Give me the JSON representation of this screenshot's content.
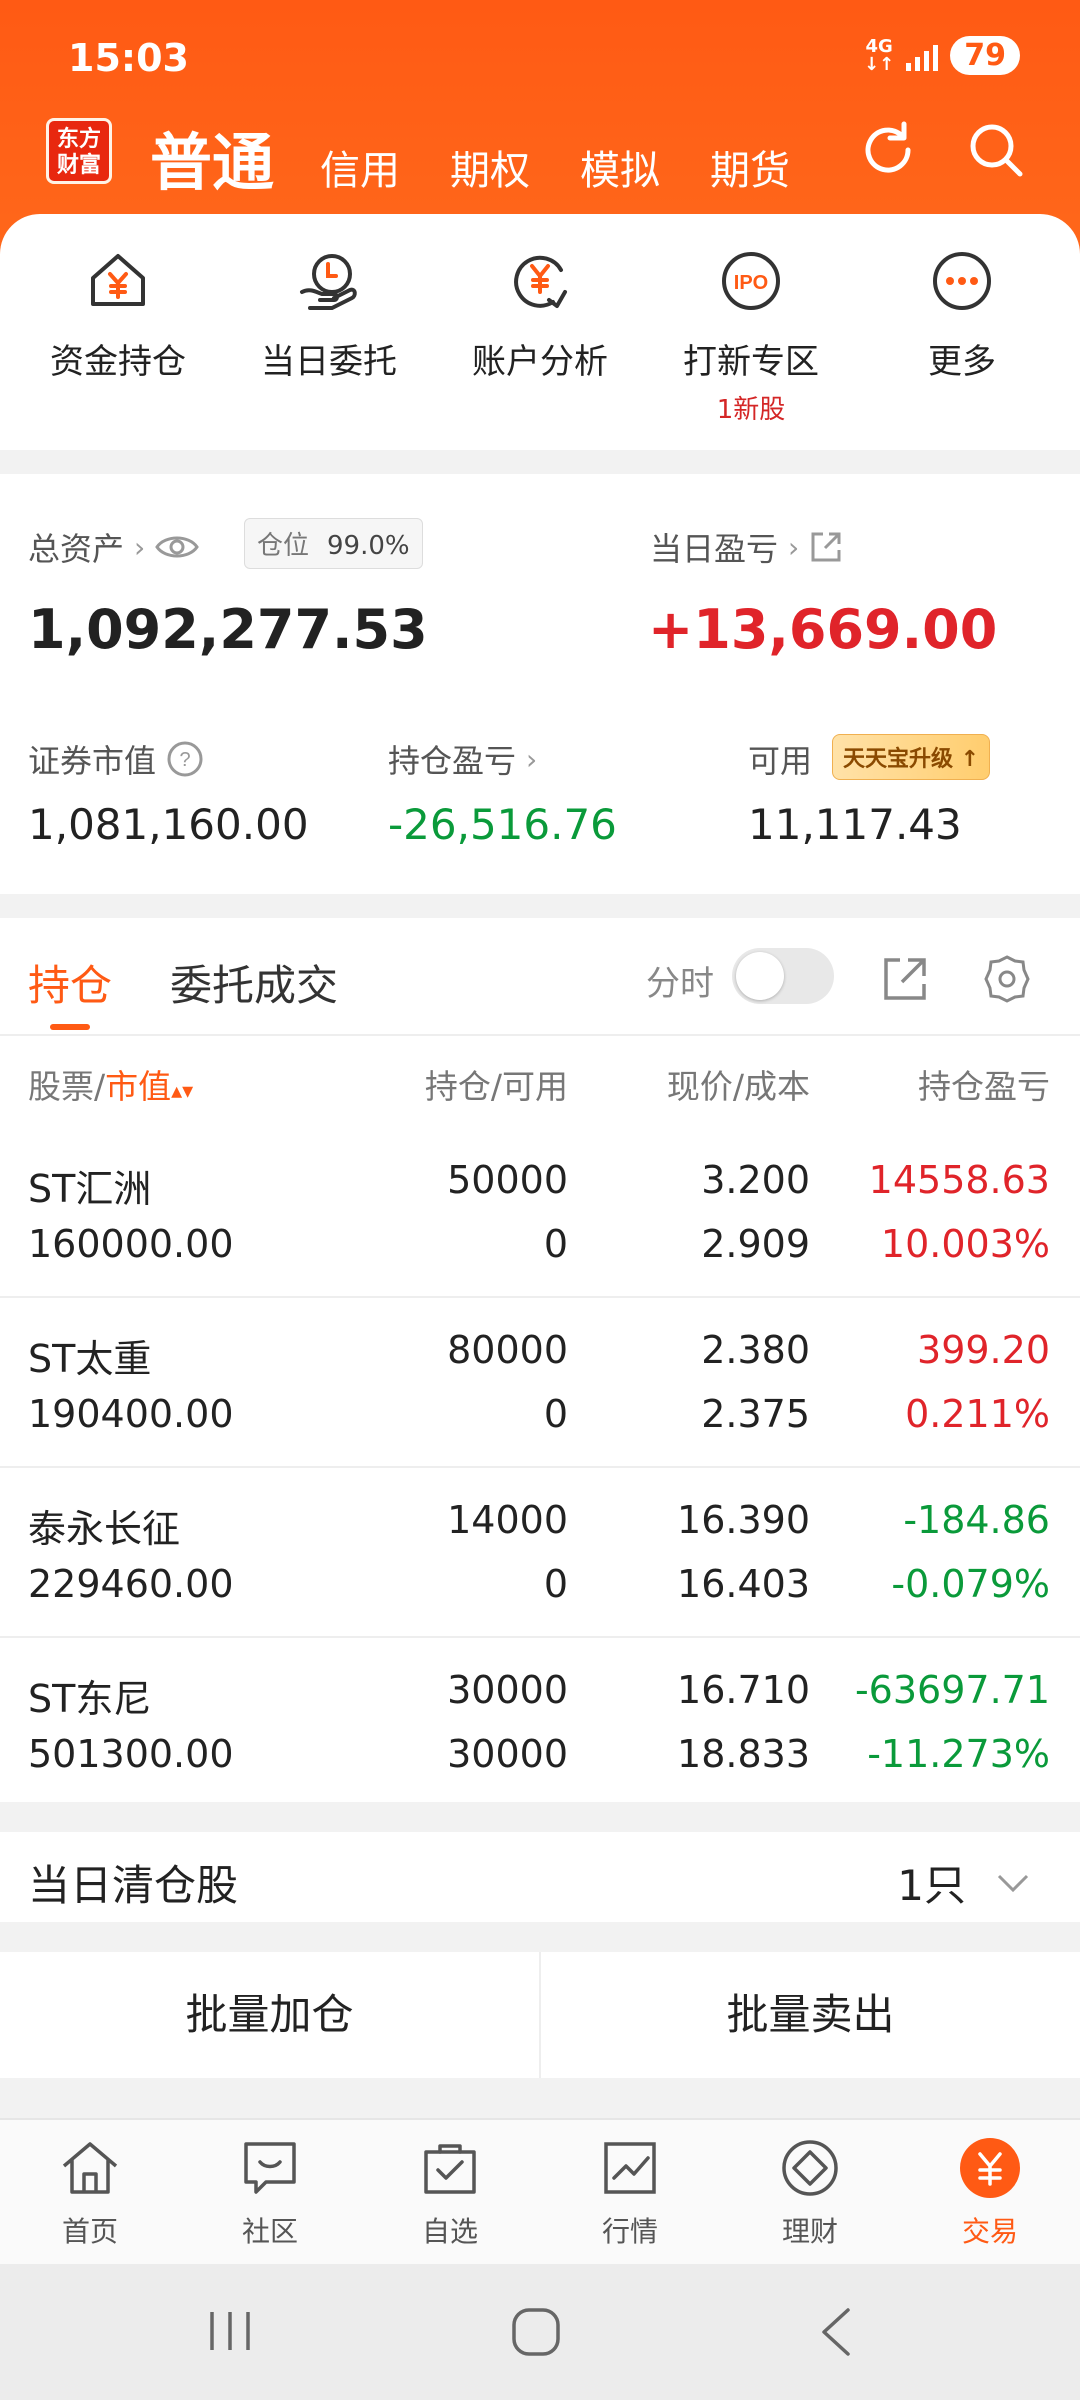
{
  "status": {
    "time": "15:03",
    "network": "4G",
    "battery": "79"
  },
  "header": {
    "logo_line1": "东方",
    "logo_line2": "财富",
    "active_tab": "普通",
    "tabs": [
      "信用",
      "期权",
      "模拟",
      "期货"
    ]
  },
  "quick_actions": [
    {
      "label": "资金持仓",
      "icon": "house-yen-icon"
    },
    {
      "label": "当日委托",
      "icon": "hand-clock-icon"
    },
    {
      "label": "账户分析",
      "icon": "yen-chart-icon"
    },
    {
      "label": "打新专区",
      "icon": "ipo-icon",
      "sub": "1新股"
    },
    {
      "label": "更多",
      "icon": "more-dots-icon"
    }
  ],
  "assets": {
    "total_label": "总资产",
    "position_label": "仓位",
    "position_value": "99.0%",
    "total_value": "1,092,277.53",
    "daily_pl_label": "当日盈亏",
    "daily_pl_value": "+13,669.00",
    "market_value_label": "证券市值",
    "market_value": "1,081,160.00",
    "holding_pl_label": "持仓盈亏",
    "holding_pl_value": "-26,516.76",
    "available_label": "可用",
    "upgrade_badge": "天天宝升级",
    "available_value": "11,117.43",
    "colors": {
      "up": "#e0242a",
      "down": "#0a9a3a"
    }
  },
  "holdings": {
    "tab_active": "持仓",
    "tab_other": "委托成交",
    "fenshi_label": "分时",
    "headers": {
      "stock": "股票/",
      "stock_sort": "市值",
      "qty": "持仓/可用",
      "price": "现价/成本",
      "pl": "持仓盈亏"
    },
    "rows": [
      {
        "name": "ST汇洲",
        "value": "160000.00",
        "qty": "50000",
        "avail": "0",
        "price": "3.200",
        "cost": "2.909",
        "pl": "14558.63",
        "pl_pct": "10.003%",
        "trend": "up"
      },
      {
        "name": "ST太重",
        "value": "190400.00",
        "qty": "80000",
        "avail": "0",
        "price": "2.380",
        "cost": "2.375",
        "pl": "399.20",
        "pl_pct": "0.211%",
        "trend": "up"
      },
      {
        "name": "泰永长征",
        "value": "229460.00",
        "qty": "14000",
        "avail": "0",
        "price": "16.390",
        "cost": "16.403",
        "pl": "-184.86",
        "pl_pct": "-0.079%",
        "trend": "down"
      },
      {
        "name": "ST东尼",
        "value": "501300.00",
        "qty": "30000",
        "avail": "30000",
        "price": "16.710",
        "cost": "18.833",
        "pl": "-63697.71",
        "pl_pct": "-11.273%",
        "trend": "down"
      }
    ]
  },
  "cleared": {
    "label": "当日清仓股",
    "count": "1只"
  },
  "batch": {
    "add": "批量加仓",
    "sell": "批量卖出"
  },
  "tabbar": [
    {
      "label": "首页",
      "icon": "home-icon"
    },
    {
      "label": "社区",
      "icon": "chat-icon"
    },
    {
      "label": "自选",
      "icon": "bag-check-icon"
    },
    {
      "label": "行情",
      "icon": "chart-icon"
    },
    {
      "label": "理财",
      "icon": "diamond-icon"
    },
    {
      "label": "交易",
      "icon": "trade-yen-icon",
      "active": true
    }
  ]
}
